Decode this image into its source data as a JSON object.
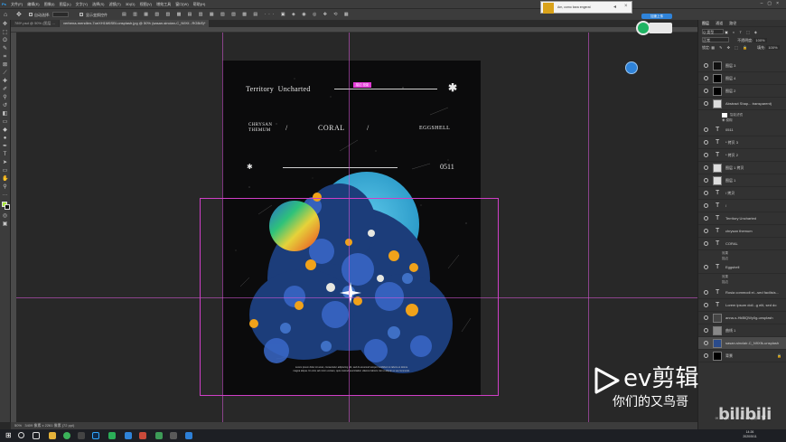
{
  "menubar": {
    "items": [
      "文件(F)",
      "编辑(E)",
      "图像(I)",
      "图层(L)",
      "文字(Y)",
      "选择(S)",
      "滤镜(T)",
      "3D(D)",
      "视图(V)",
      "增效工具",
      "窗口(W)",
      "帮助(H)"
    ]
  },
  "options": {
    "auto_select": "自动选择:",
    "transform": "显示变换控件"
  },
  "tabs": [
    {
      "label": "789*.psd @ 50% (图层 ..."
    },
    {
      "label": "verbena-mendlen-7oeXH1M6SBI-unsplash.jpg @ 50% (sasan-sincian-C_N9Xf...RGB/8)*"
    }
  ],
  "notification": {
    "text": "Am, como bara engerat"
  },
  "artboard": {
    "title_left": "Territory",
    "title_right": "Uncharted",
    "highlight_tag": "描边 投影",
    "chrysan": "CHRYSAN",
    "themum": "THEMUM",
    "slash": "/",
    "coral": "CORAL",
    "slash2": "/",
    "eggshell": "EGGSHELL",
    "number": "0511",
    "body_text_1": "Lorem ipsum dolor sit amet, consectetur adipiscing elit, sed do eiusmod tempor incididunt ut labore et dolore",
    "body_text_2": "magna aliqua. Ut enim ad minim veniam, quis nostrud exercitation ullamco laboris nisi ut aliquip ex ea commodo."
  },
  "status": {
    "zoom": "50%",
    "doc": "3409 像素 x 2261 像素 (72 ppi)"
  },
  "layers_panel": {
    "tab_layers": "图层",
    "tab_channels": "通道",
    "tab_paths": "路径",
    "kind": "Q 类型",
    "blend": "正常",
    "opacity_label": "不透明度:",
    "opacity": "100%",
    "lock_label": "锁定:",
    "fill_label": "填充:",
    "fill": "100%",
    "layers": [
      {
        "name": "图层 3",
        "type": "pixel"
      },
      {
        "name": "图层 4",
        "type": "pixel"
      },
      {
        "name": "图层 2",
        "type": "pixel"
      },
      {
        "name": "Abstract Shap... transparent)",
        "type": "smart"
      },
      {
        "name": "智能滤镜",
        "type": "filter"
      },
      {
        "name": "模糊",
        "type": "filter"
      },
      {
        "name": "0511",
        "type": "text"
      },
      {
        "name": "* 拷贝 3",
        "type": "text"
      },
      {
        "name": "* 拷贝 2",
        "type": "text"
      },
      {
        "name": "图层 1 拷贝",
        "type": "pixel"
      },
      {
        "name": "图层 1",
        "type": "pixel"
      },
      {
        "name": "/ 拷贝",
        "type": "text"
      },
      {
        "name": "/",
        "type": "text"
      },
      {
        "name": "Territory Uncharted",
        "type": "text"
      },
      {
        "name": "chrysan themum",
        "type": "text"
      },
      {
        "name": "CORAL",
        "type": "text"
      },
      {
        "name": "效果",
        "type": "fx"
      },
      {
        "name": "描边",
        "type": "fx"
      },
      {
        "name": "Eggshell",
        "type": "text"
      },
      {
        "name": "效果",
        "type": "fx"
      },
      {
        "name": "描边",
        "type": "fx"
      },
      {
        "name": "Rosia commodi ei...sed facilisis...",
        "type": "text"
      },
      {
        "name": "Lorem ipsum doli...g elit, sed do",
        "type": "text"
      },
      {
        "name": "anna-s-HkBlQWy0g-unsplash",
        "type": "pixel"
      },
      {
        "name": "曲线 1",
        "type": "adjust"
      },
      {
        "name": "sasan-sinclair-C_N9Xfk-unsplash",
        "type": "pixel"
      },
      {
        "name": "背景",
        "type": "pixel"
      }
    ]
  },
  "watermark": {
    "brand": "ev剪辑",
    "sub": "你们的又鸟哥",
    "site": "bilibili"
  },
  "badge": {
    "label": "加速上传"
  },
  "clock": {
    "time": "14:26",
    "date": "2020/5/11"
  },
  "colors": {
    "accent_guide": "#cf3fc6",
    "highlight": "#e43ad8"
  }
}
